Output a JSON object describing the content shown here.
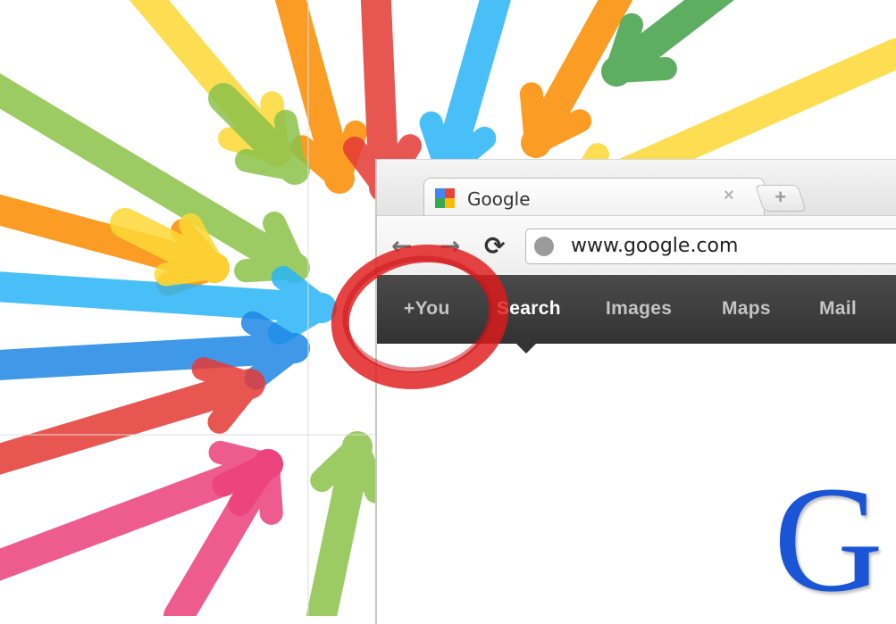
{
  "browser": {
    "tab": {
      "title": "Google",
      "close_glyph": "×",
      "favicon_icon": "google-favicon-icon"
    },
    "new_tab_glyph": "+",
    "toolbar": {
      "back_glyph": "←",
      "forward_glyph": "→",
      "reload_glyph": "⟳",
      "omnibox": {
        "url": "www.google.com",
        "icon": "globe-icon"
      }
    }
  },
  "gbar": {
    "items": [
      {
        "label": "+You",
        "active": false
      },
      {
        "label": "Search",
        "active": true
      },
      {
        "label": "Images",
        "active": false
      },
      {
        "label": "Maps",
        "active": false
      },
      {
        "label": "Mail",
        "active": false
      }
    ]
  },
  "logo": {
    "text": "G"
  },
  "colors": {
    "gbar_bg": "#333333",
    "logo_blue": "#1a55d6",
    "circle_red": "#e01b1b",
    "arrow_palette": [
      "#e53935",
      "#1e88e5",
      "#43a047",
      "#fdd835",
      "#fb8c00",
      "#29b6f6",
      "#8bc34a",
      "#ec407a"
    ]
  }
}
